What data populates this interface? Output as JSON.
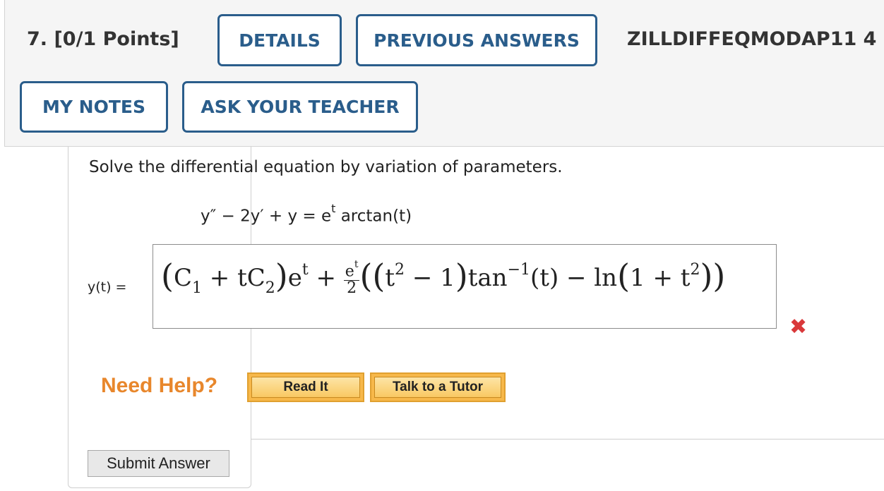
{
  "header": {
    "question_number": "7. [0/1 Points]",
    "details_label": "DETAILS",
    "previous_answers_label": "PREVIOUS ANSWERS",
    "question_code": "ZILLDIFFEQMODAP11 4",
    "my_notes_label": "MY NOTES",
    "ask_teacher_label": "ASK YOUR TEACHER"
  },
  "question": {
    "prompt": "Solve the differential equation by variation of parameters.",
    "equation_lhs": "y″ − 2y′ + y = e",
    "equation_exp": "t",
    "equation_rhs": " arctan(t)"
  },
  "answer": {
    "label": "y(t) =",
    "status": "incorrect",
    "mark": "✖",
    "parts": {
      "open1": "(",
      "c1": "C",
      "c1_sub": "1",
      "mid1": " + tC",
      "c2_sub": "2",
      "close1": ")",
      "e1": "e",
      "e1_exp": "t",
      "plus": " + ",
      "frac_num": "e",
      "frac_num_exp": "t",
      "frac_den": "2",
      "open2": "((",
      "t2": "t",
      "t2_exp": "2",
      "minus1": " − 1",
      "close2": ")",
      "tan": "tan",
      "tan_exp": "−1",
      "targ": "(t) − ln",
      "open3": "(",
      "one_plus_t": "1 + t",
      "t3_exp": "2",
      "close3": "))"
    }
  },
  "help": {
    "label": "Need Help?",
    "read_it": "Read It",
    "tutor": "Talk to a Tutor"
  },
  "submit_label": "Submit Answer",
  "colors": {
    "button_blue": "#2a5d8b",
    "help_orange": "#e8872c",
    "error_red": "#d9383a"
  }
}
